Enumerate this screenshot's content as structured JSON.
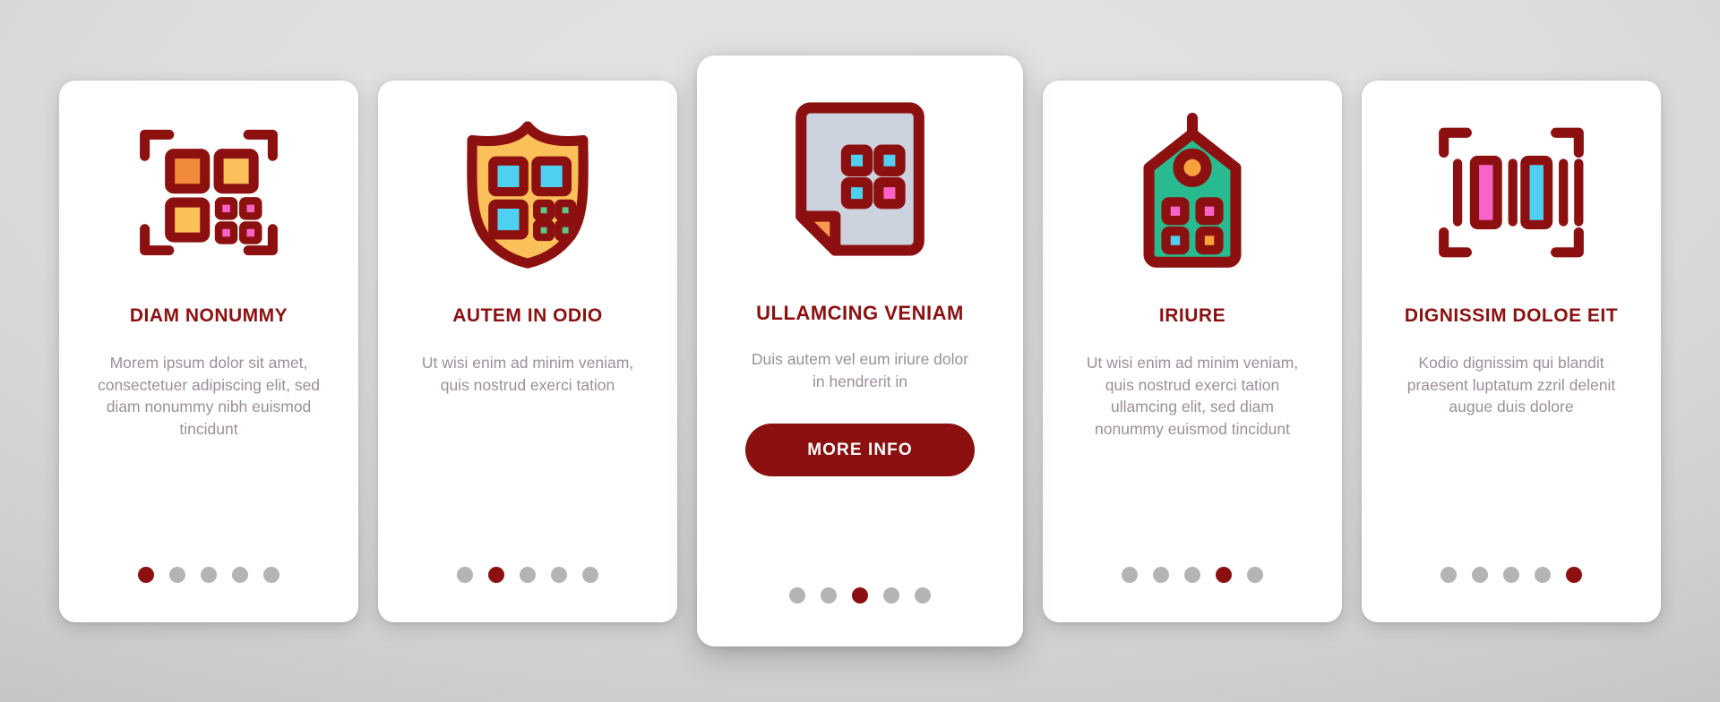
{
  "theme": {
    "accent": "#8d1010",
    "body_text": "#9b8f9b",
    "dot_inactive": "#b4b4b4",
    "card_bg": "#ffffff",
    "page_bg": "#d5d5d5"
  },
  "cards": [
    {
      "icon": "qr-code-scan-icon",
      "title": "DIAM NONUMMY",
      "body": "Morem ipsum dolor sit amet, consectetuer adipiscing elit, sed diam nonummy nibh euismod tincidunt",
      "featured": false,
      "dots_total": 5,
      "dot_active_index": 0,
      "cta_label": null
    },
    {
      "icon": "shield-qr-icon",
      "title": "AUTEM IN ODIO",
      "body": "Ut wisi enim ad minim veniam, quis nostrud exerci tation",
      "featured": false,
      "dots_total": 5,
      "dot_active_index": 1,
      "cta_label": null
    },
    {
      "icon": "document-qr-icon",
      "title": "ULLAMCING VENIAM",
      "body": "Duis autem vel eum iriure dolor in hendrerit in",
      "featured": true,
      "dots_total": 5,
      "dot_active_index": 2,
      "cta_label": "MORE INFO"
    },
    {
      "icon": "price-tag-qr-icon",
      "title": "IRIURE",
      "body": "Ut wisi enim ad minim veniam, quis nostrud exerci tation ullamcing elit, sed diam nonummy euismod tincidunt",
      "featured": false,
      "dots_total": 5,
      "dot_active_index": 3,
      "cta_label": null
    },
    {
      "icon": "barcode-scan-icon",
      "title": "DIGNISSIM DOLOE EIT",
      "body": "Kodio dignissim qui blandit praesent luptatum zzril delenit augue duis dolore",
      "featured": false,
      "dots_total": 5,
      "dot_active_index": 4,
      "cta_label": null
    }
  ],
  "icon_colors": {
    "outline": "#8d1010",
    "qr_square_orange": "#f28a3c",
    "qr_square_amber": "#fbc05a",
    "qr_dot_pink": "#f963c8",
    "shield_fill": "#fbc05a",
    "shield_square_cyan": "#4fd0f0",
    "shield_dot_green": "#5cc98c",
    "doc_fill": "#ccd3de",
    "doc_corner_orange": "#f79a4f",
    "doc_dot_cyan": "#4fd0f0",
    "doc_dot_pink": "#f963c8",
    "tag_fill": "#29bb8f",
    "tag_ring_orange": "#f7a23c",
    "tag_dot_pink": "#f963c8",
    "tag_dot_cyan": "#4fd0f0",
    "tag_dot_orange": "#f7a23c",
    "bar_pink": "#f963c8",
    "bar_cyan": "#4fd0f0"
  }
}
